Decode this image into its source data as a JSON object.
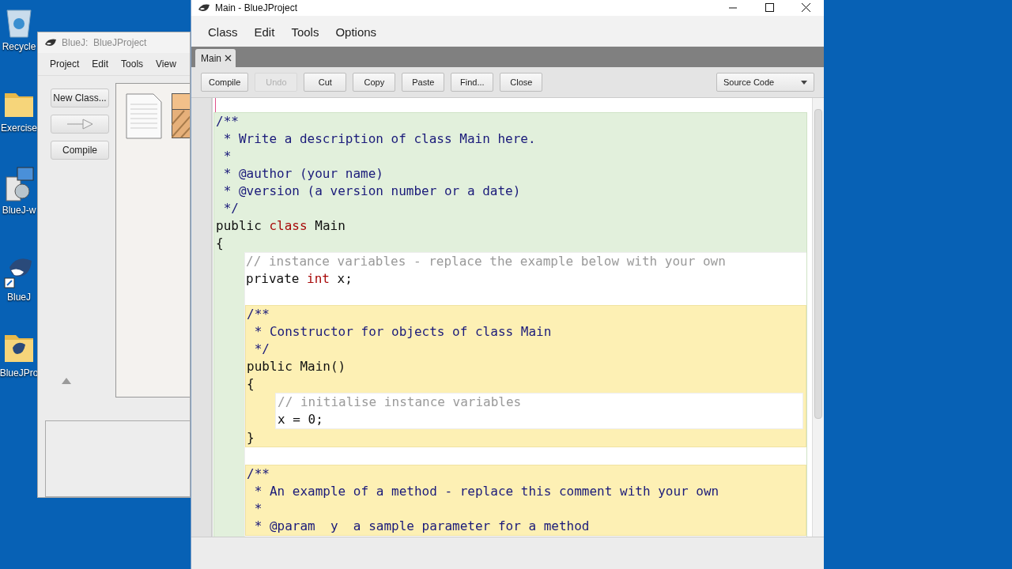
{
  "desktop_icons": [
    {
      "label": "Recycle",
      "kind": "trash"
    },
    {
      "label": "Exercise",
      "kind": "folder"
    },
    {
      "label": "BlueJ-w",
      "kind": "installer"
    },
    {
      "label": "BlueJ",
      "kind": "shortcut"
    },
    {
      "label": "BlueJPro",
      "kind": "project"
    }
  ],
  "project_window": {
    "title": "BlueJ:  BlueJProject",
    "menu": [
      "Project",
      "Edit",
      "Tools",
      "View"
    ],
    "buttons": [
      {
        "kind": "text",
        "label": "New Class...",
        "disabled": false
      },
      {
        "kind": "arrow",
        "disabled": true
      },
      {
        "kind": "text",
        "label": "Compile",
        "disabled": false
      }
    ]
  },
  "editor_window": {
    "title": "Main - BlueJProject",
    "menu": [
      "Class",
      "Edit",
      "Tools",
      "Options"
    ],
    "tabs": [
      {
        "label": "Main",
        "selected": true
      }
    ],
    "toolbar": [
      {
        "label": "Compile",
        "disabled": false
      },
      {
        "label": "Undo",
        "disabled": true
      },
      {
        "label": "Cut",
        "disabled": false
      },
      {
        "label": "Copy",
        "disabled": false
      },
      {
        "label": "Paste",
        "disabled": false
      },
      {
        "label": "Find...",
        "disabled": false
      },
      {
        "label": "Close",
        "disabled": false
      }
    ],
    "view_select": {
      "value": "Source Code"
    },
    "code": {
      "header": [
        [
          {
            "kind": "javadoc",
            "text": "/**"
          }
        ],
        [
          {
            "kind": "javadoc",
            "text": " * Write a description of class Main here."
          }
        ],
        [
          {
            "kind": "javadoc",
            "text": " *"
          }
        ],
        [
          {
            "kind": "javadoc",
            "text": " * @author (your name)"
          }
        ],
        [
          {
            "kind": "javadoc",
            "text": " * @version (a version number or a date)"
          }
        ],
        [
          {
            "kind": "javadoc",
            "text": " */"
          }
        ],
        [
          {
            "kind": "plain",
            "text": "public "
          },
          {
            "kind": "keyword",
            "text": "class"
          },
          {
            "kind": "plain",
            "text": " Main"
          }
        ],
        [
          {
            "kind": "plain",
            "text": "{"
          }
        ]
      ],
      "members": [
        {
          "kind": "fields",
          "lines": [
            [
              {
                "kind": "comment",
                "text": "// instance variables - replace the example below with your own"
              }
            ],
            [
              {
                "kind": "plain",
                "text": "private "
              },
              {
                "kind": "keyword",
                "text": "int"
              },
              {
                "kind": "plain",
                "text": " x;"
              }
            ]
          ]
        },
        {
          "kind": "method",
          "header": [
            [
              {
                "kind": "javadoc",
                "text": "/**"
              }
            ],
            [
              {
                "kind": "javadoc",
                "text": " * Constructor for objects of class Main"
              }
            ],
            [
              {
                "kind": "javadoc",
                "text": " */"
              }
            ],
            [
              {
                "kind": "plain",
                "text": "public Main()"
              }
            ],
            [
              {
                "kind": "plain",
                "text": "{"
              }
            ]
          ],
          "body": [
            [
              {
                "kind": "comment",
                "text": "// initialise instance variables"
              }
            ],
            [
              {
                "kind": "plain",
                "text": "x = 0;"
              }
            ]
          ],
          "footer": [
            [
              {
                "kind": "plain",
                "text": "}"
              }
            ]
          ]
        },
        {
          "kind": "method",
          "header": [
            [
              {
                "kind": "javadoc",
                "text": "/**"
              }
            ],
            [
              {
                "kind": "javadoc",
                "text": " * An example of a method - replace this comment with your own"
              }
            ],
            [
              {
                "kind": "javadoc",
                "text": " *"
              }
            ],
            [
              {
                "kind": "javadoc",
                "text": " * @param  y  a sample parameter for a method"
              }
            ]
          ]
        }
      ]
    }
  }
}
